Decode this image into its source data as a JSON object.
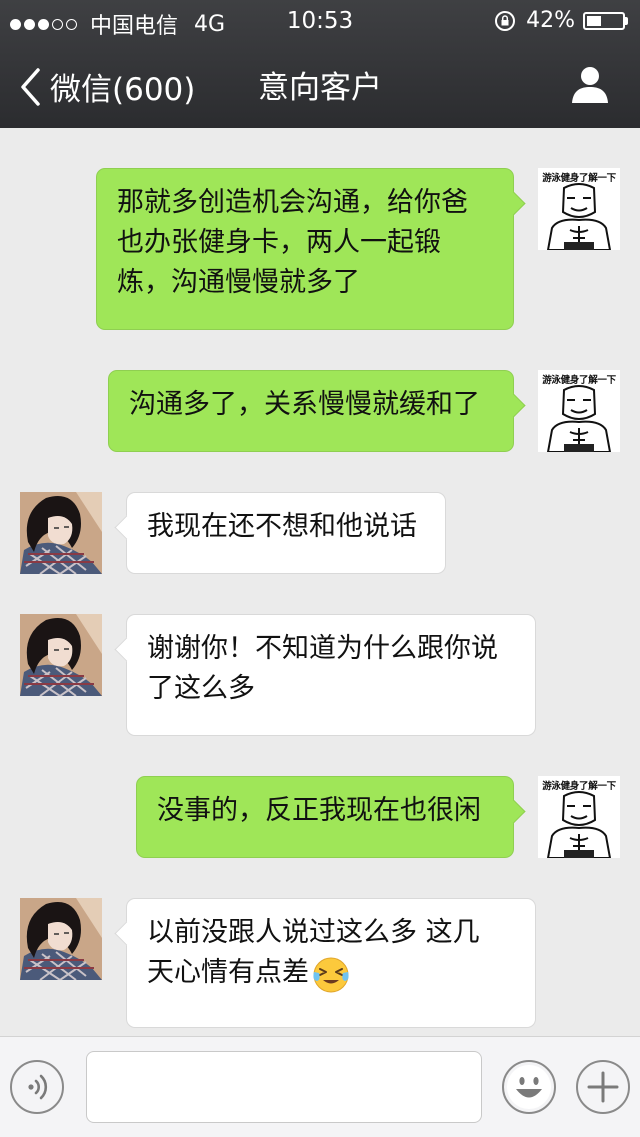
{
  "status_bar": {
    "signal": {
      "filled": 3,
      "empty": 2
    },
    "carrier": "中国电信",
    "network": "4G",
    "time": "10:53",
    "battery_text": "42%",
    "battery_level": 0.42
  },
  "nav": {
    "back_label": "微信(600)",
    "title": "意向客户",
    "right_icon": "person-icon"
  },
  "self_avatar_caption": "游泳健身了解一下",
  "messages": [
    {
      "from": "self",
      "lines": [
        "那就多创造机会沟通，给你爸",
        "也办张健身卡，两人一起锻",
        "炼，沟通慢慢就多了"
      ]
    },
    {
      "from": "self",
      "lines": [
        "沟通多了，关系慢慢就缓和了"
      ]
    },
    {
      "from": "other",
      "lines": [
        "我现在还不想和他说话"
      ]
    },
    {
      "from": "other",
      "lines": [
        "谢谢你！不知道为什么跟你说",
        "了这么多"
      ]
    },
    {
      "from": "self",
      "lines": [
        "没事的，反正我现在也很闲"
      ]
    },
    {
      "from": "other",
      "lines": [
        "以前没跟人说过这么多 这几",
        "天心情有点差"
      ],
      "trailing_emoji": "crying-laughing-face-icon"
    }
  ],
  "input_bar": {
    "voice_icon": "voice-icon",
    "input_value": "",
    "emoji_icon": "smiley-icon",
    "more_icon": "plus-icon"
  },
  "colors": {
    "nav_bg": "#2e2f32",
    "chat_bg": "#ebebeb",
    "self_bubble": "#9fe658",
    "other_bubble": "#ffffff"
  }
}
